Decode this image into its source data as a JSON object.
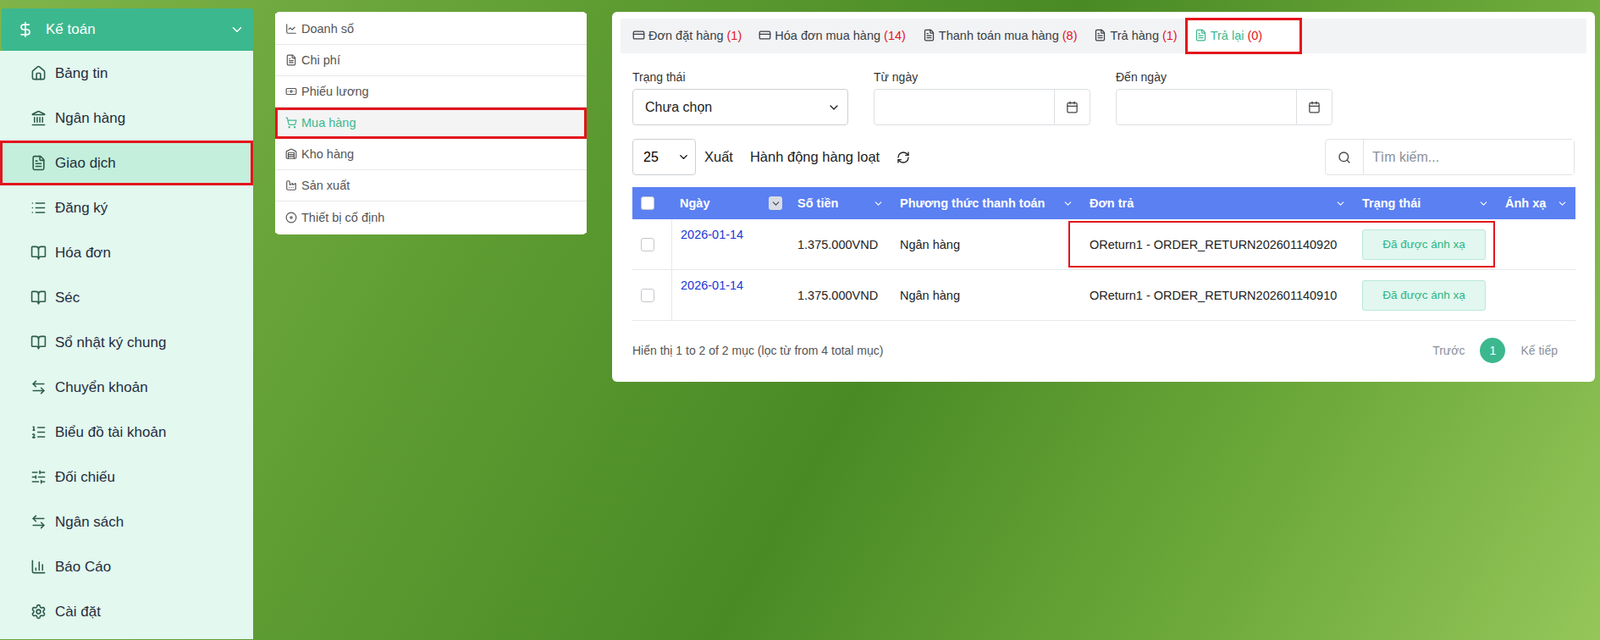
{
  "sidebar": {
    "title": "Kế toán",
    "items": [
      {
        "label": "Bảng tin",
        "selected": false,
        "highlighted": false
      },
      {
        "label": "Ngân hàng",
        "selected": false,
        "highlighted": false
      },
      {
        "label": "Giao dịch",
        "selected": true,
        "highlighted": true
      },
      {
        "label": "Đăng ký",
        "selected": false,
        "highlighted": false
      },
      {
        "label": "Hóa đơn",
        "selected": false,
        "highlighted": false
      },
      {
        "label": "Séc",
        "selected": false,
        "highlighted": false
      },
      {
        "label": "Sổ nhật ký chung",
        "selected": false,
        "highlighted": false
      },
      {
        "label": "Chuyển khoản",
        "selected": false,
        "highlighted": false
      },
      {
        "label": "Biểu đồ tài khoản",
        "selected": false,
        "highlighted": false
      },
      {
        "label": "Đối chiếu",
        "selected": false,
        "highlighted": false
      },
      {
        "label": "Ngân sách",
        "selected": false,
        "highlighted": false
      },
      {
        "label": "Báo Cáo",
        "selected": false,
        "highlighted": false
      },
      {
        "label": "Cài đặt",
        "selected": false,
        "highlighted": false
      }
    ]
  },
  "submenu": {
    "items": [
      {
        "label": "Doanh số",
        "selected": false,
        "highlighted": false
      },
      {
        "label": "Chi phí",
        "selected": false,
        "highlighted": false
      },
      {
        "label": "Phiếu lương",
        "selected": false,
        "highlighted": false
      },
      {
        "label": "Mua hàng",
        "selected": true,
        "highlighted": true
      },
      {
        "label": "Kho hàng",
        "selected": false,
        "highlighted": false
      },
      {
        "label": "Sản xuất",
        "selected": false,
        "highlighted": false
      },
      {
        "label": "Thiết bị cố định",
        "selected": false,
        "highlighted": false
      }
    ]
  },
  "tabs": [
    {
      "label": "Đơn đặt hàng",
      "count": "(1)",
      "selected": false,
      "highlighted": false
    },
    {
      "label": "Hóa đơn mua hàng",
      "count": "(14)",
      "selected": false,
      "highlighted": false
    },
    {
      "label": "Thanh toán mua hàng",
      "count": "(8)",
      "selected": false,
      "highlighted": false
    },
    {
      "label": "Trả hàng",
      "count": "(1)",
      "selected": false,
      "highlighted": false
    },
    {
      "label": "Trả lại",
      "count": "(0)",
      "selected": true,
      "highlighted": true
    }
  ],
  "filters": [
    {
      "label": "Trạng thái",
      "kind": "select",
      "value": "Chưa chọn"
    },
    {
      "label": "Từ ngày",
      "kind": "date",
      "value": ""
    },
    {
      "label": "Đến ngày",
      "kind": "date",
      "value": ""
    }
  ],
  "toolbar": {
    "page_size": "25",
    "buttons": [
      "Xuất",
      "Hành động hàng loạt"
    ],
    "search_placeholder": "Tìm kiếm..."
  },
  "table": {
    "all_checked": false,
    "columns": [
      {
        "label": "Ngày",
        "sorted": true
      },
      {
        "label": "Số tiền",
        "sorted": false
      },
      {
        "label": "Phương thức thanh toán",
        "sorted": false
      },
      {
        "label": "Đơn trả",
        "sorted": false
      },
      {
        "label": "Trạng thái",
        "sorted": false
      },
      {
        "label": "Ánh xạ",
        "sorted": false
      }
    ],
    "rows": [
      {
        "checked": false,
        "date": "2026-01-14",
        "amount": "1.375.000VND",
        "method": "Ngân hàng",
        "order": "OReturn1 - ORDER_RETURN202601140920",
        "status": "Đã được ánh xạ",
        "highlighted": true
      },
      {
        "checked": false,
        "date": "2026-01-14",
        "amount": "1.375.000VND",
        "method": "Ngân hàng",
        "order": "OReturn1 - ORDER_RETURN202601140910",
        "status": "Đã được ánh xạ",
        "highlighted": false
      }
    ]
  },
  "footer": {
    "info": "Hiển thị 1 to 2 of 2 mục (lọc từ from 4 total mục)",
    "pagination": [
      {
        "label": "Trước",
        "kind": "link",
        "selected": false
      },
      {
        "label": "1",
        "kind": "page",
        "selected": true
      },
      {
        "label": "Kế tiếp",
        "kind": "link",
        "selected": false
      }
    ]
  }
}
